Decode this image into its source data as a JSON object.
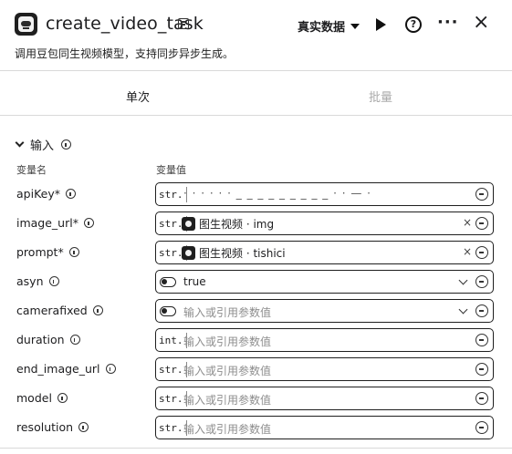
{
  "header": {
    "title": "create_video_task",
    "description": "调用豆包同生视频模型，支持同步异步生成。",
    "data_source": "真实数据"
  },
  "tabs": {
    "single": "单次",
    "batch": "批量"
  },
  "section": {
    "title": "输入",
    "col_name": "变量名",
    "col_value": "变量值"
  },
  "params": [
    {
      "name": "apiKey",
      "required": "*",
      "type": "str.",
      "value": "·  ·  · · · ·  _ _ _ _ _ _ _ _ _   ·   ·   —  ·"
    },
    {
      "name": "image_url",
      "required": "*",
      "type": "str.",
      "value": "图生视频 · img"
    },
    {
      "name": "prompt",
      "required": "*",
      "type": "str.",
      "value": "图生视频 · tishici"
    },
    {
      "name": "asyn",
      "required": "",
      "type": "",
      "value": "true"
    },
    {
      "name": "camerafixed",
      "required": "",
      "type": "",
      "placeholder": "输入或引用参数值"
    },
    {
      "name": "duration",
      "required": "",
      "type": "int.",
      "placeholder": "输入或引用参数值"
    },
    {
      "name": "end_image_url",
      "required": "",
      "type": "str.",
      "placeholder": "输入或引用参数值"
    },
    {
      "name": "model",
      "required": "",
      "type": "str.",
      "placeholder": "输入或引用参数值"
    },
    {
      "name": "resolution",
      "required": "",
      "type": "str.",
      "placeholder": "输入或引用参数值"
    }
  ],
  "icons": {
    "app": "video-plugin-icon",
    "edit": "edit-note-icon",
    "run": "play-icon",
    "help": "help-icon",
    "more": "more-icon",
    "close": "close-icon"
  }
}
